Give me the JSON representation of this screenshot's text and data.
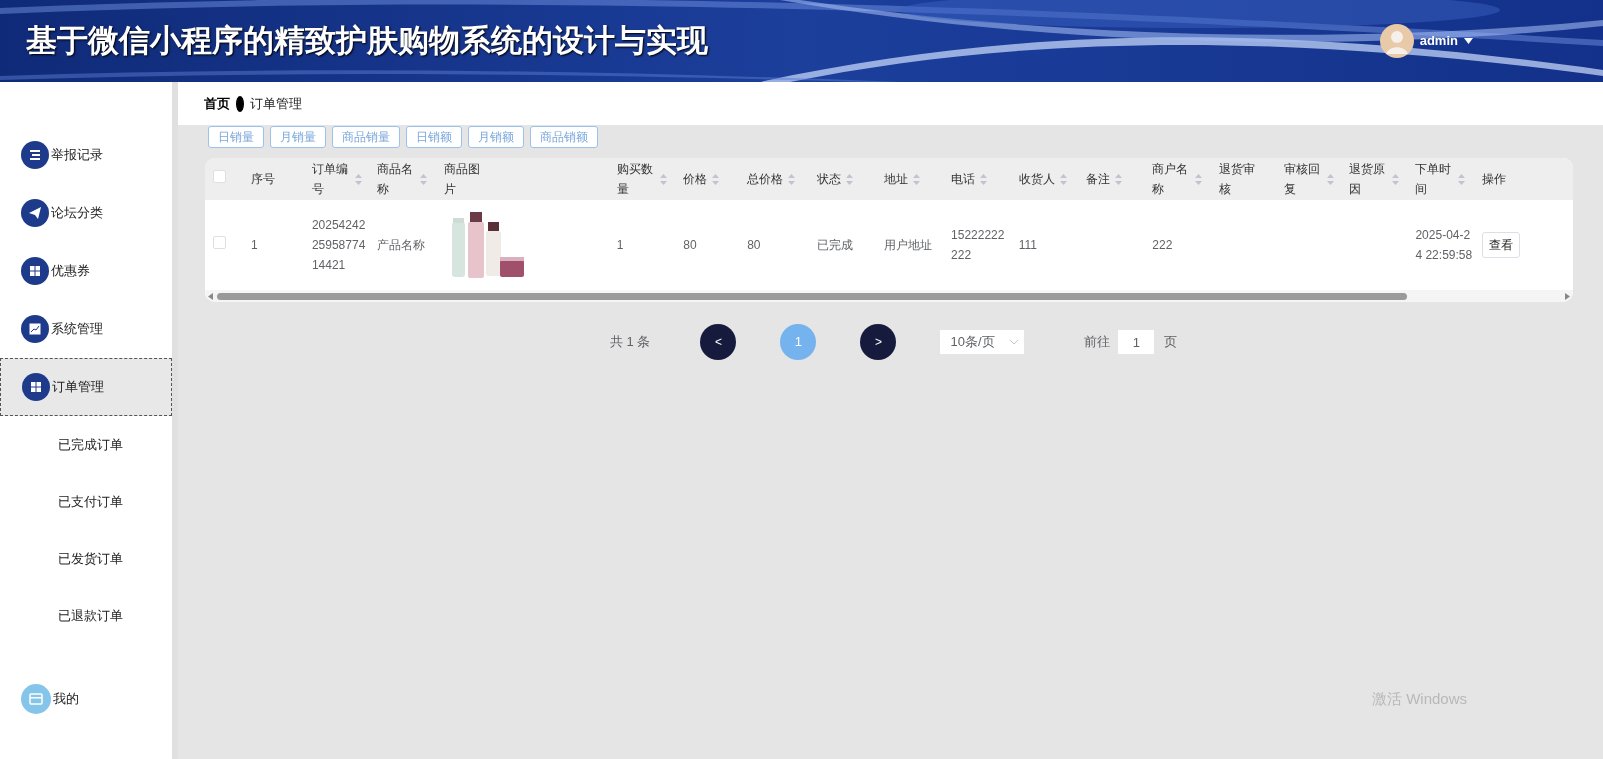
{
  "header": {
    "title": "基于微信小程序的精致护肤购物系统的设计与实现",
    "user": "admin"
  },
  "sidebar": {
    "items": [
      {
        "label": "举报记录",
        "selected": false
      },
      {
        "label": "论坛分类",
        "selected": false
      },
      {
        "label": "优惠券",
        "selected": false
      },
      {
        "label": "系统管理",
        "selected": false
      },
      {
        "label": "订单管理",
        "selected": true,
        "children": [
          {
            "label": "已完成订单"
          },
          {
            "label": "已支付订单"
          },
          {
            "label": "已发货订单"
          },
          {
            "label": "已退款订单"
          }
        ]
      },
      {
        "label": "我的",
        "selected": false
      }
    ]
  },
  "breadcrumb": [
    "首页",
    "订单管理"
  ],
  "stat_buttons": [
    "日销量",
    "月销量",
    "商品销量",
    "日销额",
    "月销额",
    "商品销额"
  ],
  "table": {
    "columns": [
      {
        "label": "序号",
        "sortable": false
      },
      {
        "label": "订单编号",
        "sortable": true
      },
      {
        "label": "商品名称",
        "sortable": true
      },
      {
        "label": "商品图片",
        "sortable": false
      },
      {
        "label": "购买数量",
        "sortable": true
      },
      {
        "label": "价格",
        "sortable": true
      },
      {
        "label": "总价格",
        "sortable": true
      },
      {
        "label": "状态",
        "sortable": true
      },
      {
        "label": "地址",
        "sortable": true
      },
      {
        "label": "电话",
        "sortable": true
      },
      {
        "label": "收货人",
        "sortable": true
      },
      {
        "label": "备注",
        "sortable": true
      },
      {
        "label": "商户名称",
        "sortable": true
      },
      {
        "label": "退货审核",
        "sortable": false
      },
      {
        "label": "审核回复",
        "sortable": true
      },
      {
        "label": "退货原因",
        "sortable": true
      },
      {
        "label": "下单时间",
        "sortable": true
      },
      {
        "label": "操作",
        "sortable": false
      }
    ],
    "select_all": {
      "checked": false
    },
    "rows": [
      {
        "checked": false,
        "index": "1",
        "order_no": "202542422595877414421",
        "product_name": "产品名称",
        "quantity": "1",
        "price": "80",
        "total": "80",
        "status": "已完成",
        "address": "用户地址",
        "phone": "15222222222",
        "receiver": "111",
        "merchant": "222",
        "time": "2025-04-24 22:59:58",
        "action": "查看"
      }
    ]
  },
  "pagination": {
    "total": "共 1 条",
    "prev": "<",
    "pages": [
      {
        "label": "1",
        "selected": true
      }
    ],
    "next": ">",
    "page_size": "10条/页",
    "goto_label": "前往",
    "goto_value": "1",
    "goto_unit": "页"
  },
  "os_notice": "激活 Windows"
}
